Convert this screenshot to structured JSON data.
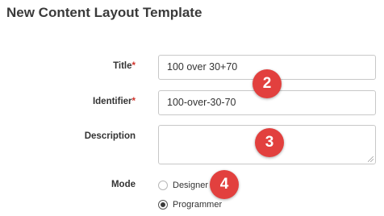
{
  "page": {
    "title": "New Content Layout Template"
  },
  "form": {
    "title": {
      "label": "Title",
      "required_mark": "*",
      "value": "100 over 30+70"
    },
    "identifier": {
      "label": "Identifier",
      "required_mark": "*",
      "value": "100-over-30-70"
    },
    "description": {
      "label": "Description",
      "value": ""
    },
    "mode": {
      "label": "Mode",
      "options": [
        {
          "label": "Designer",
          "selected": false
        },
        {
          "label": "Programmer",
          "selected": true
        }
      ]
    }
  },
  "callouts": [
    "2",
    "3",
    "4"
  ],
  "colors": {
    "callout": "#e2403e",
    "required": "#d0342c"
  }
}
